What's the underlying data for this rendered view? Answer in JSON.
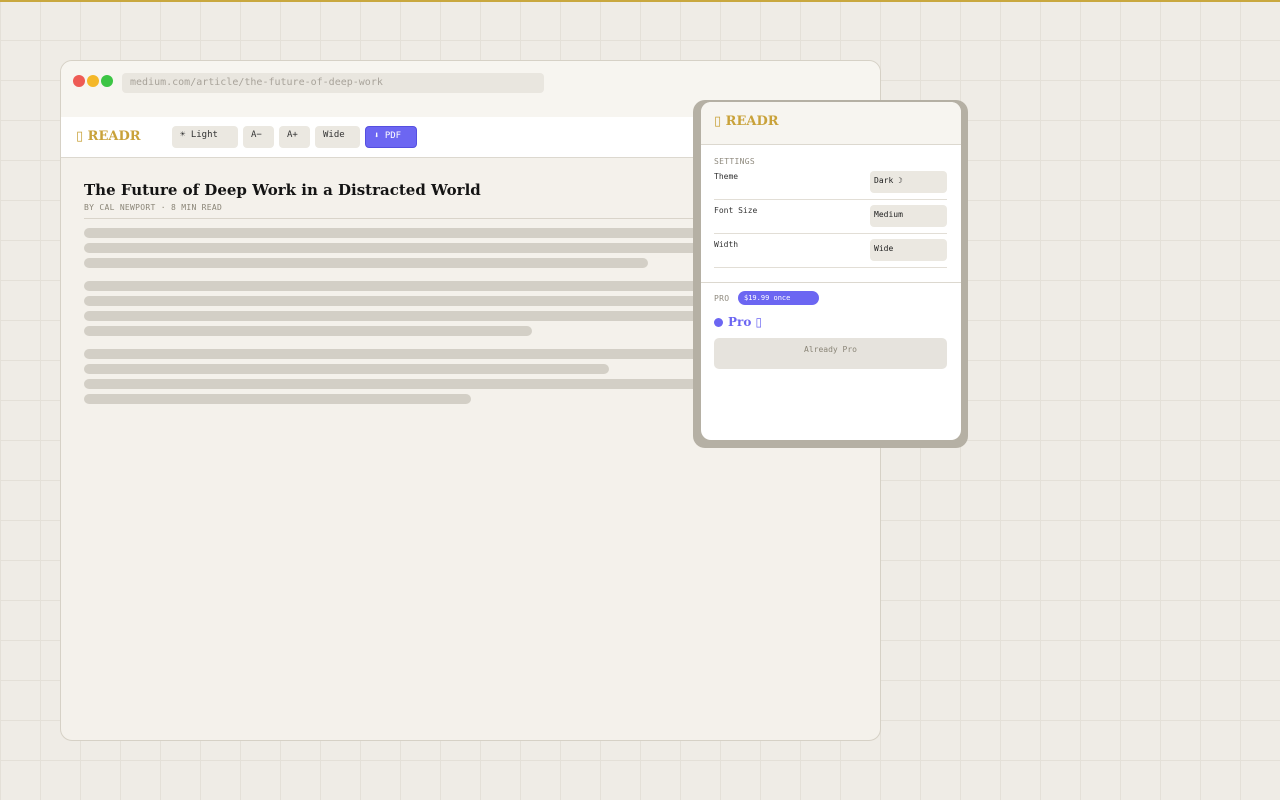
{
  "browser": {
    "url": "medium.com/article/the-future-of-deep-work"
  },
  "toolbar": {
    "brand": "▯ READR",
    "buttons": [
      {
        "label": "☀ Light"
      },
      {
        "label": "A−"
      },
      {
        "label": "A+"
      },
      {
        "label": "Wide"
      },
      {
        "label": "⬇ PDF"
      }
    ]
  },
  "article": {
    "title": "The Future of Deep Work in a Distracted World",
    "byline": "BY CAL NEWPORT  ·  8 MIN READ"
  },
  "popup": {
    "brand": "▯ READR",
    "settings_label": "SETTINGS",
    "settings": [
      {
        "label": "Theme",
        "value": "Dark ☽"
      },
      {
        "label": "Font Size",
        "value": "Medium"
      },
      {
        "label": "Width",
        "value": "Wide"
      }
    ],
    "pro_label": "PRO",
    "price": "$19.99 once",
    "pro_status": "Pro ▯",
    "already_pro_label": "Already Pro"
  },
  "colors": {
    "accent_gold": "#c9a23a",
    "accent_purple": "#6c66f2",
    "background": "#efece6"
  }
}
